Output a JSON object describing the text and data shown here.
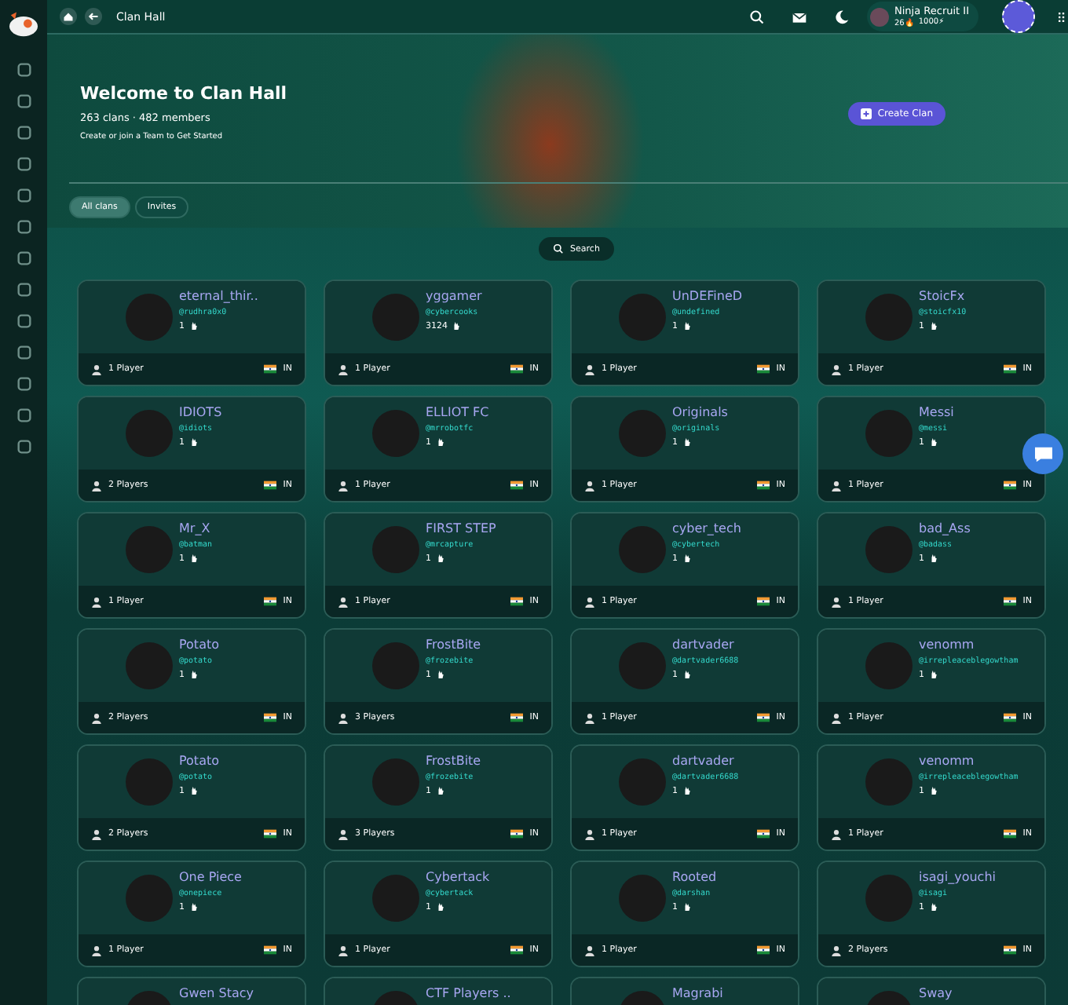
{
  "topbar": {
    "breadcrumb": "Clan Hall",
    "user": {
      "name": "Ninja Recruit II",
      "streak": "26🔥",
      "points": "1000⚡"
    }
  },
  "hero": {
    "title": "Welcome to Clan Hall",
    "stats": "263 clans · 482 members",
    "subtitle": "Create or join a Team to Get Started",
    "create_button": "Create Clan"
  },
  "tabs": [
    {
      "label": "All clans",
      "selected": true
    },
    {
      "label": "Invites",
      "selected": false
    }
  ],
  "search_button": "Search",
  "clans": [
    {
      "name": "eternal_thir..",
      "handle": "@rudhra0x0",
      "count": "1",
      "players": "1 Player",
      "country": "IN"
    },
    {
      "name": "yggamer",
      "handle": "@cybercooks",
      "count": "3124",
      "players": "1 Player",
      "country": "IN"
    },
    {
      "name": "UnDEFineD",
      "handle": "@undefined",
      "count": "1",
      "players": "1 Player",
      "country": "IN"
    },
    {
      "name": "StoicFx",
      "handle": "@stoicfx10",
      "count": "1",
      "players": "1 Player",
      "country": "IN"
    },
    {
      "name": "IDIOTS",
      "handle": "@idiots",
      "count": "1",
      "players": "2 Players",
      "country": "IN"
    },
    {
      "name": "ELLIOT FC",
      "handle": "@mrrobotfc",
      "count": "1",
      "players": "1 Player",
      "country": "IN"
    },
    {
      "name": "Originals",
      "handle": "@originals",
      "count": "1",
      "players": "1 Player",
      "country": "IN"
    },
    {
      "name": "Messi",
      "handle": "@messi",
      "count": "1",
      "players": "1 Player",
      "country": "IN"
    },
    {
      "name": "Mr_X",
      "handle": "@batman",
      "count": "1",
      "players": "1 Player",
      "country": "IN"
    },
    {
      "name": "FIRST STEP",
      "handle": "@mrcapture",
      "count": "1",
      "players": "1 Player",
      "country": "IN"
    },
    {
      "name": "cyber_tech",
      "handle": "@cybertech",
      "count": "1",
      "players": "1 Player",
      "country": "IN"
    },
    {
      "name": "bad_Ass",
      "handle": "@badass",
      "count": "1",
      "players": "1 Player",
      "country": "IN"
    },
    {
      "name": "Potato",
      "handle": "@potato",
      "count": "1",
      "players": "2 Players",
      "country": "IN"
    },
    {
      "name": "FrostBite",
      "handle": "@frozebite",
      "count": "1",
      "players": "3 Players",
      "country": "IN"
    },
    {
      "name": "dartvader",
      "handle": "@dartvader6688",
      "count": "1",
      "players": "1 Player",
      "country": "IN"
    },
    {
      "name": "venomm",
      "handle": "@irrepleaceblegowtham",
      "count": "1",
      "players": "1 Player",
      "country": "IN"
    },
    {
      "name": "Potato",
      "handle": "@potato",
      "count": "1",
      "players": "2 Players",
      "country": "IN"
    },
    {
      "name": "FrostBite",
      "handle": "@frozebite",
      "count": "1",
      "players": "3 Players",
      "country": "IN"
    },
    {
      "name": "dartvader",
      "handle": "@dartvader6688",
      "count": "1",
      "players": "1 Player",
      "country": "IN"
    },
    {
      "name": "venomm",
      "handle": "@irrepleaceblegowtham",
      "count": "1",
      "players": "1 Player",
      "country": "IN"
    },
    {
      "name": "One Piece",
      "handle": "@onepiece",
      "count": "1",
      "players": "1 Player",
      "country": "IN"
    },
    {
      "name": "Cybertack",
      "handle": "@cybertack",
      "count": "1",
      "players": "1 Player",
      "country": "IN"
    },
    {
      "name": "Rooted",
      "handle": "@darshan",
      "count": "1",
      "players": "1 Player",
      "country": "IN"
    },
    {
      "name": "isagi_youchi",
      "handle": "@isagi",
      "count": "1",
      "players": "2 Players",
      "country": "IN"
    },
    {
      "name": "Gwen Stacy"
    },
    {
      "name": "CTF Players .."
    },
    {
      "name": "Magrabi"
    },
    {
      "name": "Sway"
    }
  ]
}
